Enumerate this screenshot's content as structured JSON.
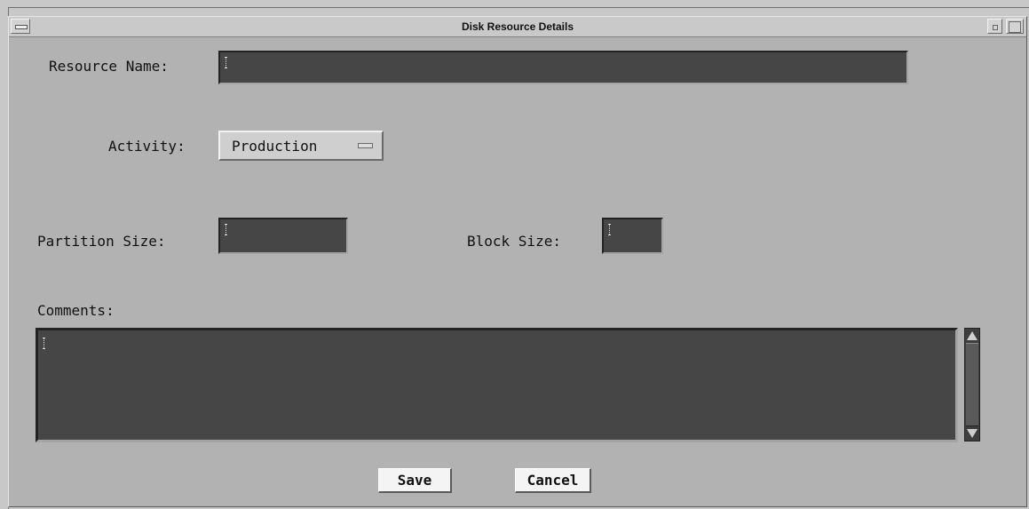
{
  "window": {
    "title": "Disk Resource Details"
  },
  "form": {
    "resource_name_label": "Resource Name:",
    "resource_name_value": "",
    "activity_label": "Activity:",
    "activity_value": "Production",
    "partition_size_label": "Partition Size:",
    "partition_size_value": "",
    "block_size_label": "Block Size:",
    "block_size_value": "",
    "comments_label": "Comments:",
    "comments_value": ""
  },
  "buttons": {
    "save": "Save",
    "cancel": "Cancel"
  },
  "icons": {
    "window_menu": "window-menu-icon",
    "minimize": "minimize-icon",
    "maximize": "maximize-icon",
    "option_indicator": "option-menu-indicator-icon",
    "text_cursor": "text-cursor-icon",
    "scroll_up": "scroll-up-arrow-icon",
    "scroll_down": "scroll-down-arrow-icon"
  },
  "colors": {
    "window_bg": "#b2b2b2",
    "titlebar_bg": "#c9c9c9",
    "field_bg": "#464646",
    "button_bg": "#f4f4f4"
  }
}
